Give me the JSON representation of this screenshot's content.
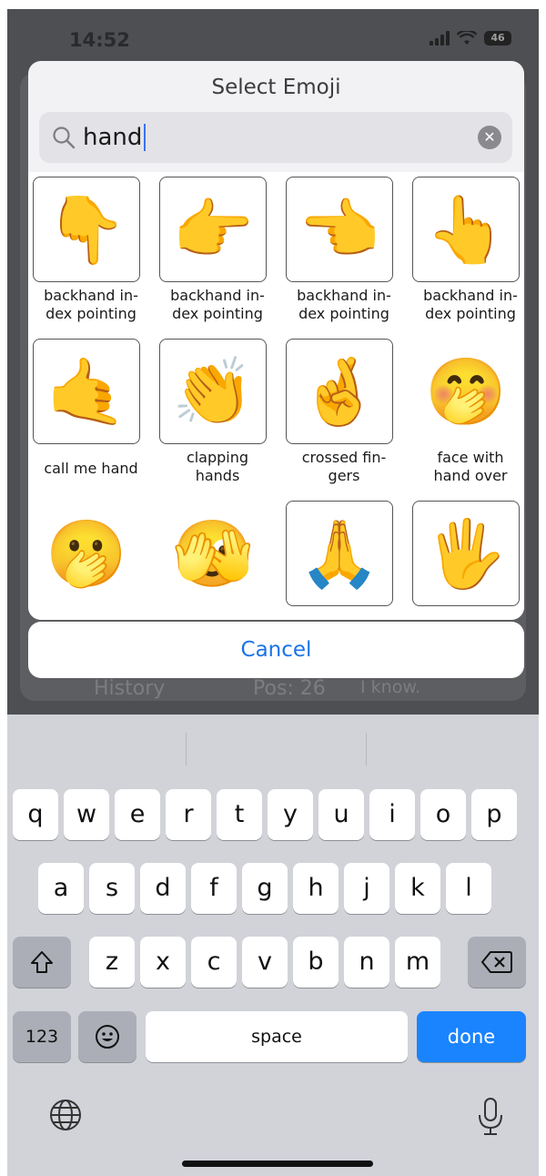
{
  "status_bar": {
    "time": "14:52",
    "battery": "46"
  },
  "background": {
    "history_label": "History",
    "pos_label": "Pos: 26",
    "note": "I know."
  },
  "dialog": {
    "title": "Select Emoji",
    "search": {
      "value": "hand",
      "clear_icon": "clear-icon"
    },
    "items": [
      {
        "emoji": "👇",
        "label": "backhand in-\ndex pointing"
      },
      {
        "emoji": "👉",
        "label": "backhand in-\ndex pointing"
      },
      {
        "emoji": "👈",
        "label": "backhand in-\ndex pointing"
      },
      {
        "emoji": "👆",
        "label": "backhand in-\ndex pointing"
      },
      {
        "emoji": "🤙",
        "label": "call me hand"
      },
      {
        "emoji": "👏",
        "label": "clapping\nhands"
      },
      {
        "emoji": "🤞",
        "label": "crossed fin-\ngers"
      },
      {
        "emoji": "🤭",
        "label": "face with\nhand over"
      },
      {
        "emoji": "🫢",
        "label": ""
      },
      {
        "emoji": "🫣",
        "label": ""
      },
      {
        "emoji": "🙏",
        "label": ""
      },
      {
        "emoji": "🖐",
        "label": ""
      }
    ],
    "cancel_label": "Cancel"
  },
  "keyboard": {
    "row1": [
      "q",
      "w",
      "e",
      "r",
      "t",
      "y",
      "u",
      "i",
      "o",
      "p"
    ],
    "row2": [
      "a",
      "s",
      "d",
      "f",
      "g",
      "h",
      "j",
      "k",
      "l"
    ],
    "row3": [
      "z",
      "x",
      "c",
      "v",
      "b",
      "n",
      "m"
    ],
    "numbers_label": "123",
    "space_label": "space",
    "done_label": "done",
    "icons": [
      "shift-icon",
      "backspace-icon",
      "emoji-icon",
      "globe-icon",
      "microphone-icon"
    ]
  }
}
